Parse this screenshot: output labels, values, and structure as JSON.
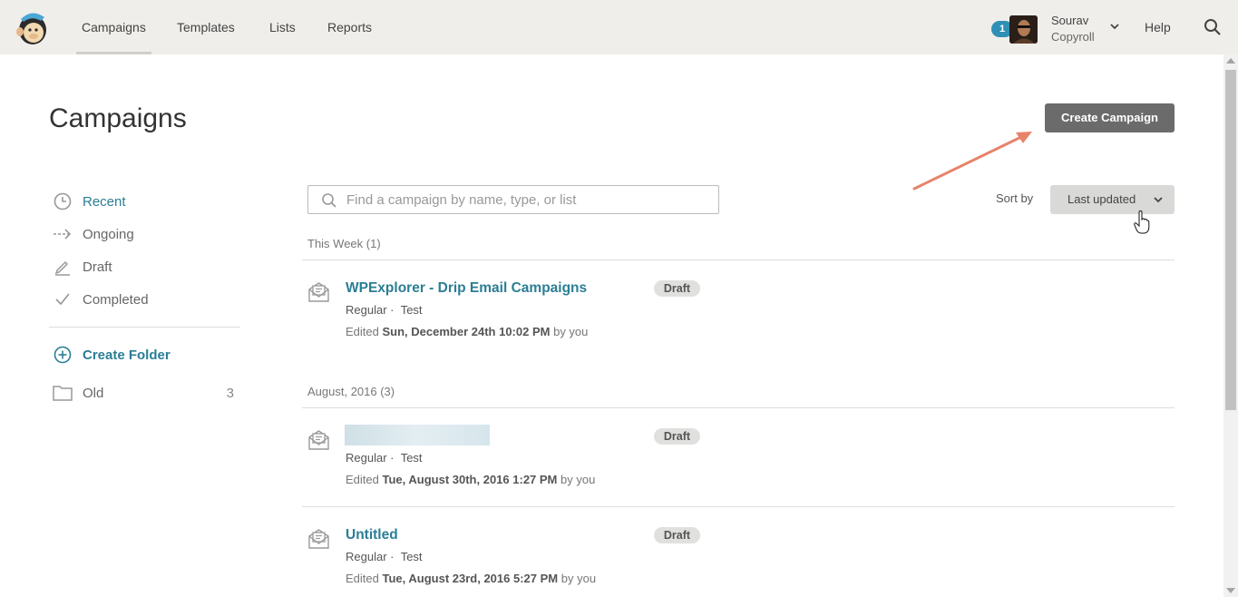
{
  "header": {
    "nav": [
      "Campaigns",
      "Templates",
      "Lists",
      "Reports"
    ],
    "notification_count": "1",
    "user_name": "Sourav",
    "user_org": "Copyroll",
    "help": "Help"
  },
  "page": {
    "title": "Campaigns",
    "create_button": "Create Campaign"
  },
  "sidebar": {
    "items": [
      {
        "label": "Recent",
        "icon": "clock-icon"
      },
      {
        "label": "Ongoing",
        "icon": "dashed-arrow-icon"
      },
      {
        "label": "Draft",
        "icon": "pencil-icon"
      },
      {
        "label": "Completed",
        "icon": "checkmark-icon"
      }
    ],
    "create_folder": "Create Folder",
    "folder": {
      "label": "Old",
      "count": "3"
    }
  },
  "toolbar": {
    "search_placeholder": "Find a campaign by name, type, or list",
    "sort_label": "Sort by",
    "sort_value": "Last updated"
  },
  "groups": [
    {
      "label": "This Week (1)",
      "campaigns": [
        {
          "title": "WPExplorer - Drip Email Campaigns",
          "type": "Regular",
          "list": "Test",
          "edited_prefix": "Edited",
          "edited_date": "Sun, December 24th 10:02 PM",
          "edited_suffix": "by you",
          "status": "Draft"
        }
      ]
    },
    {
      "label": "August, 2016 (3)",
      "campaigns": [
        {
          "title": "",
          "type": "Regular",
          "list": "Test",
          "edited_prefix": "Edited",
          "edited_date": "Tue, August 30th, 2016 1:27 PM",
          "edited_suffix": "by you",
          "status": "Draft"
        },
        {
          "title": "Untitled",
          "type": "Regular",
          "list": "Test",
          "edited_prefix": "Edited",
          "edited_date": "Tue, August 23rd, 2016 5:27 PM",
          "edited_suffix": "by you",
          "status": "Draft"
        }
      ]
    }
  ],
  "colors": {
    "accent": "#2b7e95",
    "topbar": "#efeeea",
    "button": "#6b6b6b",
    "badge": "#2f90b5",
    "arrow": "#e8836a"
  }
}
